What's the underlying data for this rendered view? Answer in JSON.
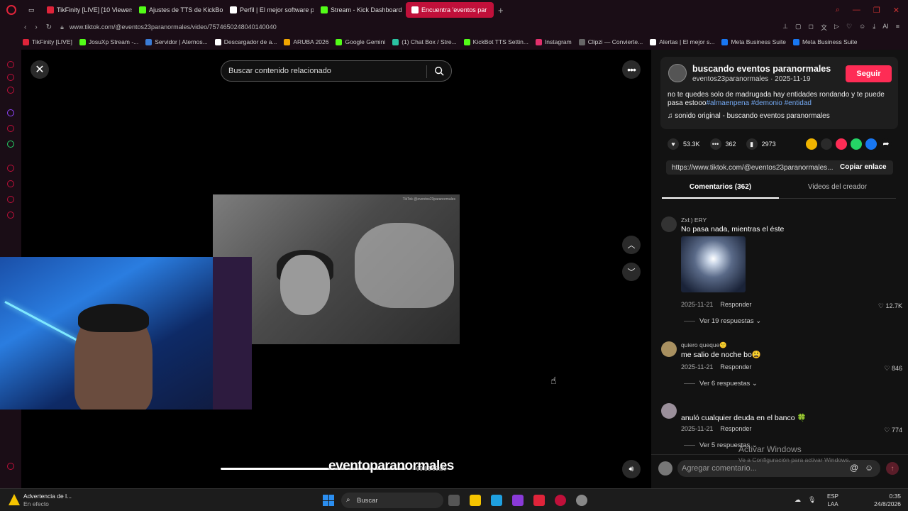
{
  "browser": {
    "tabs": [
      {
        "label": "TikFinity [LIVE] [10 Viewers",
        "color": "#e0243a"
      },
      {
        "label": "Ajustes de TTS de KickBot",
        "color": "#53fc18"
      },
      {
        "label": "Perfil | El mejor software p",
        "color": "#ffffff"
      },
      {
        "label": "Stream - Kick Dashboard",
        "color": "#53fc18"
      },
      {
        "label": "Encuentra 'eventos par",
        "color": "#ffffff",
        "active": true
      }
    ],
    "new_tab": "+",
    "url": "www.tiktok.com/@eventos23paranormales/video/7574650248040140040",
    "bookmarks": [
      {
        "label": "TikFinity [LIVE]",
        "color": "#e0243a"
      },
      {
        "label": "JosuXp Stream -...",
        "color": "#53fc18"
      },
      {
        "label": "Servidor | Aternos...",
        "color": "#3a7bd5"
      },
      {
        "label": "Descargador de a...",
        "color": "#ffffff"
      },
      {
        "label": "ARUBA 2026",
        "color": "#f0a500"
      },
      {
        "label": "Google Gemini",
        "color": "#53fc18"
      },
      {
        "label": "(1) Chat Box / Stre...",
        "color": "#2ac3a2"
      },
      {
        "label": "KickBot TTS Settin...",
        "color": "#53fc18"
      },
      {
        "label": "Instagram",
        "color": "#e1306c"
      },
      {
        "label": "Clipzi — Convierte...",
        "color": "#666666"
      },
      {
        "label": "Alertas | El mejor s...",
        "color": "#ffffff"
      },
      {
        "label": "Meta Business Suite",
        "color": "#1877f2"
      },
      {
        "label": "Meta Business Suite",
        "color": "#1877f2"
      }
    ]
  },
  "player": {
    "search_placeholder": "Buscar contenido relacionado",
    "overlay_text": "eventoparanormales",
    "time": "00:16/00:20",
    "progress": 0.8,
    "video_watermark": "TikTok\n@eventos23paranormales"
  },
  "post": {
    "author_name": "buscando eventos paranormales",
    "author_meta": "eventos23paranormales · 2025-11-19",
    "follow_label": "Seguir",
    "desc_text": "no te quedes solo de madrugada hay entidades rondando y te puede pasa estooo",
    "tags": [
      "#almaenpena",
      "#demonio",
      "#entidad"
    ],
    "music": "♫  sonido original - buscando eventos paranormales",
    "likes": "53.3K",
    "comments": "362",
    "saves": "2973",
    "link": "https://www.tiktok.com/@eventos23paranormales...",
    "copy_label": "Copiar enlace",
    "tab_comments": "Comentarios (362)",
    "tab_creator": "Videos del creador"
  },
  "comments": [
    {
      "user": "Zxl:) ERY",
      "text": "No pasa nada, mientras el éste",
      "date": "2025-11-21",
      "reply": "Responder",
      "likes": "12.7K",
      "replies": "Ver 19 respuestas"
    },
    {
      "user": "quiero queque🙁",
      "text": "me salio de noche bo😩",
      "date": "2025-11-21",
      "reply": "Responder",
      "likes": "846",
      "replies": "Ver 6 respuestas"
    },
    {
      "user": "",
      "text": "anuló cualquier deuda en el banco 🍀",
      "date": "2025-11-21",
      "reply": "Responder",
      "likes": "774",
      "replies": "Ver 5 respuestas"
    }
  ],
  "comment_bar": {
    "placeholder": "Agregar comentario..."
  },
  "windows": {
    "activate_title": "Activar Windows",
    "activate_sub": "Ve a Configuración para activar Windows."
  },
  "taskbar": {
    "warn_title": "Advertencia de l...",
    "warn_sub": "En efecto",
    "search_label": "Buscar",
    "lang_1": "ESP",
    "lang_2": "LAA",
    "time": "0:35",
    "date": "24/8/2026"
  }
}
